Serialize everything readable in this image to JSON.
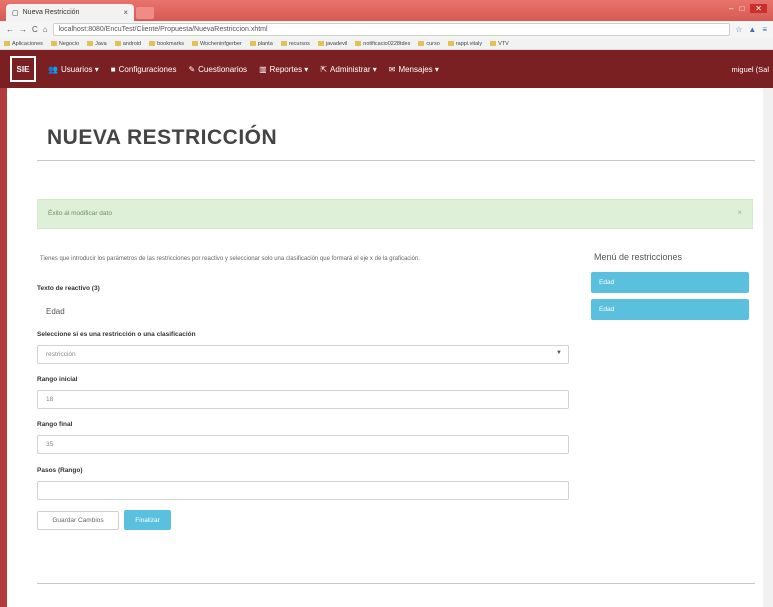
{
  "browser": {
    "tab_title": "Nueva Restricción",
    "tab_close": "×",
    "url": "localhost:8080/EncuTest/Cliente/Propuesta/NuevaRestriccion.xhtml",
    "bookmarks": [
      "Aplicaciones",
      "Negocio",
      "Java",
      "android",
      "bookmarks",
      "Wocheninfgerber",
      "planta",
      "recursos",
      "javadevil",
      "notificacio0228tdes",
      "curso",
      "rappi.vitaly",
      "VTV"
    ],
    "win_min": "–",
    "win_max": "□",
    "win_close": "✕"
  },
  "navbar": {
    "logo": "SIE",
    "items": [
      {
        "label": "Usuarios ▾",
        "icon": "users-icon"
      },
      {
        "label": "Configuraciones",
        "icon": "folder-icon"
      },
      {
        "label": "Cuestionarios",
        "icon": "edit-icon"
      },
      {
        "label": "Reportes ▾",
        "icon": "chart-icon"
      },
      {
        "label": "Administrar ▾",
        "icon": "share-icon"
      },
      {
        "label": "Mensajes ▾",
        "icon": "mail-icon"
      }
    ],
    "user": "miguel (Sal"
  },
  "page": {
    "title": "NUEVA RESTRICCIÓN",
    "alert_text": "Éxito al modificar dato",
    "alert_close": "×",
    "description": "Tienes que introducir los parámetros de las restricciones por reactivo y seleccionar solo una clasificación que formará el eje x de la graficación."
  },
  "form": {
    "reactivo_label": "Texto de reactivo (3)",
    "reactivo_value": "Edad",
    "tipo_label": "Seleccione si es una restricción o una clasificación",
    "tipo_value": "restricción",
    "rango_inicial_label": "Rango inicial",
    "rango_inicial_value": "18",
    "rango_final_label": "Rango final",
    "rango_final_value": "35",
    "pasos_label": "Pasos (Rango)",
    "pasos_value": "",
    "guardar_label": "Guardar Cambios",
    "finalizar_label": "Finalizar"
  },
  "sidebar": {
    "title": "Menú de restricciones",
    "items": [
      "Edad",
      "Edad"
    ]
  },
  "colors": {
    "navbar": "#7a1f22",
    "accent": "#5bc0de",
    "alert_bg": "#dff0d8"
  }
}
